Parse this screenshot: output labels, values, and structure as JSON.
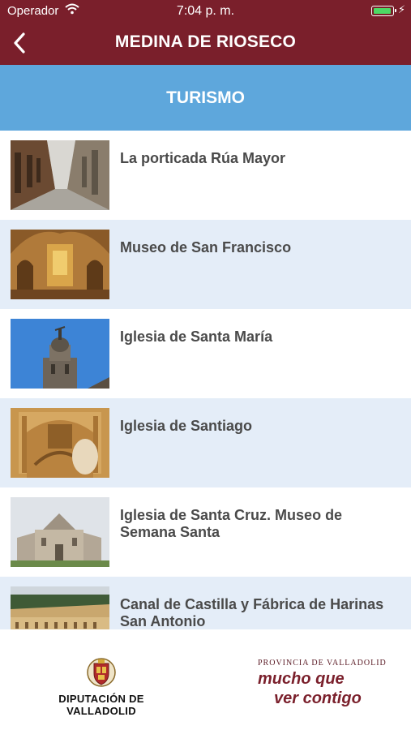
{
  "status_bar": {
    "carrier": "Operador",
    "time": "7:04 p. m.",
    "battery_color": "#4cd964"
  },
  "navbar": {
    "title": "MEDINA DE RIOSECO",
    "back_icon": "chevron-left-icon",
    "background": "#7a1f2b"
  },
  "section": {
    "title": "TURISMO",
    "background": "#5ea7dc"
  },
  "items": [
    {
      "label": "La porticada Rúa Mayor"
    },
    {
      "label": "Museo de San Francisco"
    },
    {
      "label": "Iglesia de Santa María"
    },
    {
      "label": "Iglesia de Santiago"
    },
    {
      "label": "Iglesia de Santa Cruz. Museo de Semana Santa"
    },
    {
      "label": "Canal de Castilla y Fábrica de Harinas San Antonio"
    }
  ],
  "footer": {
    "diputacion_logo": "DIPUTACIÓN DE VALLADOLID",
    "provincia_line": "PROVINCIA DE VALLADOLID",
    "slogan_line1": "mucho que",
    "slogan_line2": "ver contigo"
  }
}
